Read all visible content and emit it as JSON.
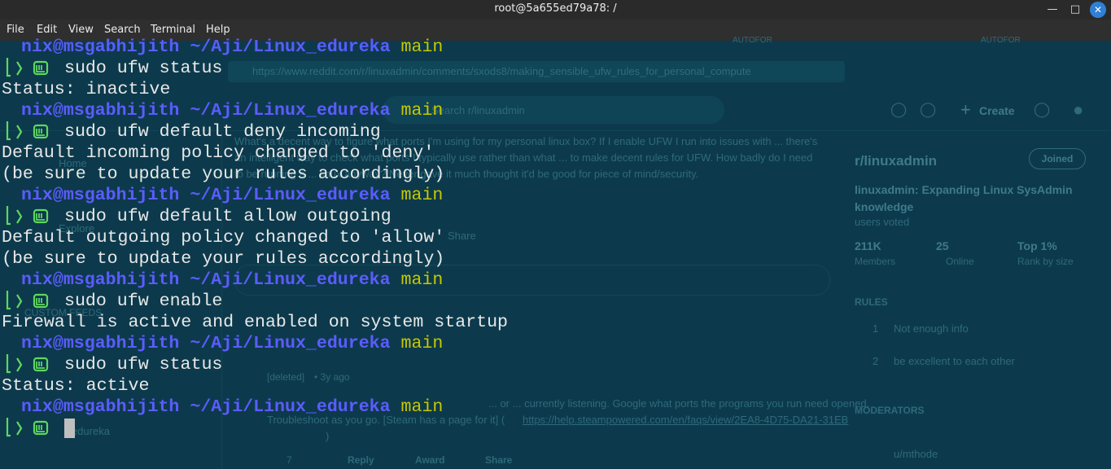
{
  "window": {
    "title": "root@5a655ed79a78: /",
    "buttons": {
      "minimize": "—",
      "maximize": "□",
      "close": "✕"
    }
  },
  "menubar": {
    "items": [
      "File",
      "Edit",
      "View",
      "Search",
      "Terminal",
      "Help"
    ]
  },
  "prompt": {
    "user": "nix@msgabhijith",
    "path": "~/Aji/Linux_edureka",
    "branch": "main",
    "icon": "linux-mint-icon"
  },
  "session": [
    {
      "type": "prompt"
    },
    {
      "type": "cmd",
      "text": "sudo ufw status"
    },
    {
      "type": "out",
      "text": "Status: inactive"
    },
    {
      "type": "prompt"
    },
    {
      "type": "cmd",
      "text": "sudo ufw default deny incoming"
    },
    {
      "type": "out",
      "text": "Default incoming policy changed to 'deny'"
    },
    {
      "type": "out",
      "text": "(be sure to update your rules accordingly)"
    },
    {
      "type": "prompt"
    },
    {
      "type": "cmd",
      "text": "sudo ufw default allow outgoing"
    },
    {
      "type": "out",
      "text": "Default outgoing policy changed to 'allow'"
    },
    {
      "type": "out",
      "text": "(be sure to update your rules accordingly)"
    },
    {
      "type": "prompt"
    },
    {
      "type": "cmd",
      "text": "sudo ufw enable"
    },
    {
      "type": "out",
      "text": "Firewall is active and enabled on system startup"
    },
    {
      "type": "prompt"
    },
    {
      "type": "cmd",
      "text": "sudo ufw status"
    },
    {
      "type": "out",
      "text": "Status: active"
    },
    {
      "type": "prompt"
    },
    {
      "type": "cursor"
    }
  ],
  "background": {
    "url": "https://www.reddit.com/r/linuxadmin/comments/sxods8/making_sensible_ufw_rules_for_personal_compute",
    "reddit_logo": "reddit",
    "search_placeholder": "Search r/linuxadmin",
    "create_label": "Create",
    "post_text": "What's a decent way to figure what ports I'm using for my personal linux box? If I enable UFW I run into issues with ... there's an intelligent way to check what ports I typically use rather than what ... to make decent rules for UFW. How badly do I need to be running a ... linux anyway? Never gave it much thought it'd be good for piece of mind/security.",
    "left_nav": [
      "Home",
      "Explore"
    ],
    "custom_feeds": "CUSTOM FEEDS",
    "community_item": "r/edureka",
    "share_label": "Share",
    "comment_author": "[deleted]",
    "comment_age": "• 3y ago",
    "comment_text": "... or ... currently listening. Google what ports the programs you run need opened.",
    "comment_text2": "Troubleshoot as you go. [Steam has a page for it] (",
    "comment_link": "https://help.steampowered.com/en/faqs/view/2EA8-4D75-DA21-31EB",
    "comment_link_end": ")",
    "comment_votes": "7",
    "reply_label": "Reply",
    "award_label": "Award",
    "share2_label": "Share",
    "sidebar": {
      "community": "r/linuxadmin",
      "joined": "Joined",
      "description": "linuxadmin: Expanding Linux SysAdmin knowledge",
      "voted": "users voted",
      "members_value": "211K",
      "members_label": "Members",
      "online_value": "25",
      "online_label": "Online",
      "rank_value": "Top 1%",
      "rank_label": "Rank by size",
      "rules_title": "RULES",
      "rules": [
        {
          "num": "1",
          "text": "Not enough info"
        },
        {
          "num": "2",
          "text": "be excellent to each other"
        }
      ],
      "moderators_title": "MODERATORS",
      "moderator": "u/mthode"
    },
    "top_labels": [
      "AUTOFOR",
      "AUTOFOR"
    ]
  },
  "colors": {
    "prompt_blue": "#5c5cff",
    "branch_yellow": "#c8c800",
    "accent_green": "#5fd75f",
    "output": "#e8e8e8",
    "background": "#0b3a4c"
  }
}
